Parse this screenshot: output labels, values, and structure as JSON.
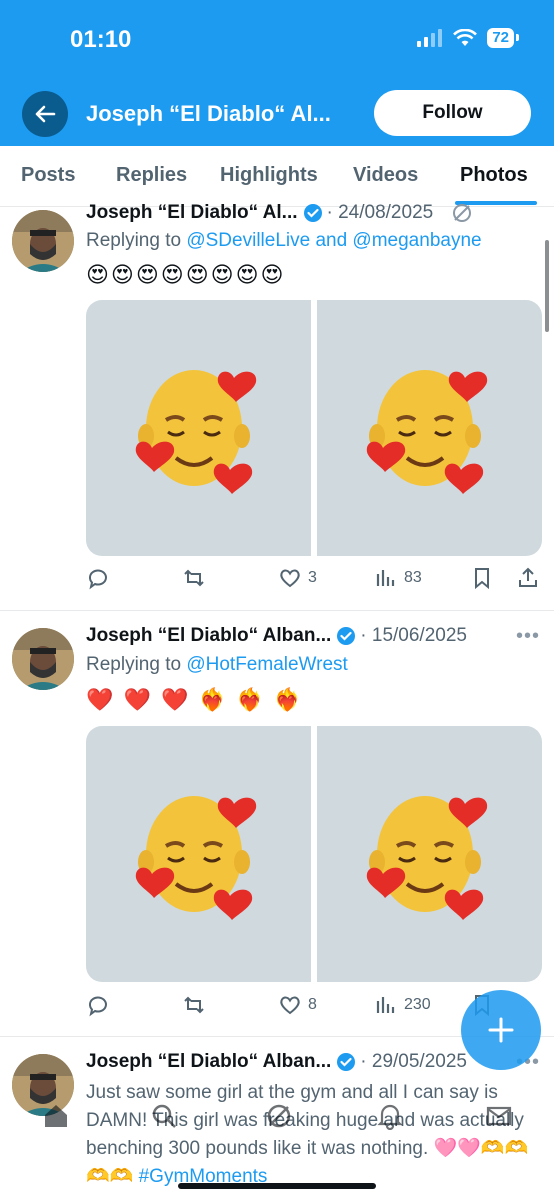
{
  "status_bar": {
    "time": "01:10",
    "battery": "72"
  },
  "header": {
    "title": "Joseph “El Diablo“ Al...",
    "follow_label": "Follow"
  },
  "tabs": [
    {
      "label": "Posts"
    },
    {
      "label": "Replies"
    },
    {
      "label": "Highlights"
    },
    {
      "label": "Videos"
    },
    {
      "label": "Photos",
      "active": true
    }
  ],
  "posts": [
    {
      "name": "Joseph “El Diablo“ Al...",
      "date": "· 24/08/2025",
      "reply_prefix": "Replying to ",
      "reply_mentions": "@SDevilleLive and @meganbayne",
      "emojis": "😍😍😍😍😍😍😍😍",
      "likes": "3",
      "views": "83"
    },
    {
      "name": "Joseph “El Diablo“ Alban...",
      "date": "· 15/06/2025",
      "reply_prefix": "Replying to ",
      "reply_mentions": "@HotFemaleWrest",
      "emojis": "❤️ ❤️ ❤️ ❤️‍🔥 ❤️‍🔥 ❤️‍🔥",
      "likes": "8",
      "views": "230"
    },
    {
      "name": "Joseph “El Diablo“ Alban...",
      "date": "· 29/05/2025",
      "text": "Just saw some girl at the gym and all I can say is DAMN! This girl was freaking huge and was actually benching 300 pounds like it was nothing. 🩷🩷🫶🫶🫶🫶",
      "hashtag": "#GymMoments"
    }
  ],
  "colors": {
    "accent": "#1d9bf0",
    "text": "#0f1419",
    "muted": "#536471"
  }
}
